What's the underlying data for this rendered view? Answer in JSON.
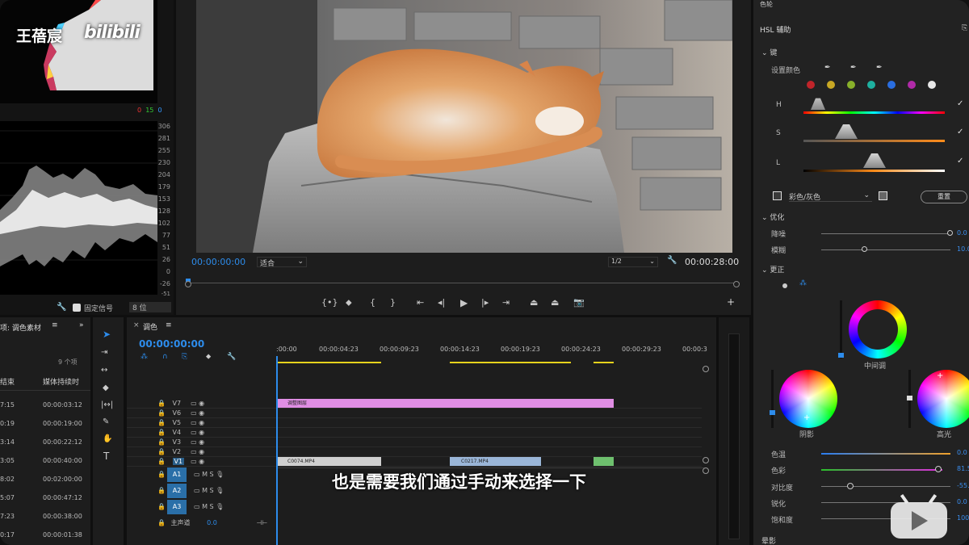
{
  "watermark": {
    "author": "王蓓宸",
    "brand": "bilibili"
  },
  "scope": {
    "ticks": [
      "306",
      "281",
      "255",
      "230",
      "204",
      "179",
      "153",
      "128",
      "102",
      "77",
      "51",
      "26",
      "0",
      "-26",
      "-51"
    ],
    "readout": [
      "0",
      "15",
      "0"
    ],
    "fixed_signal_label": "固定信号",
    "bitdepth": "8 位"
  },
  "monitor": {
    "timecode_in": "00:00:00:00",
    "fit_label": "适合",
    "res_label": "1/2",
    "timecode_out": "00:00:28:00"
  },
  "project": {
    "title": "项: 调色素材",
    "count": "9 个项",
    "col_end": "结束",
    "col_duration": "媒体持续时",
    "rows": [
      [
        "7:15",
        "00:00:03:12"
      ],
      [
        "0:19",
        "00:00:19:00"
      ],
      [
        "3:14",
        "00:00:22:12"
      ],
      [
        "3:05",
        "00:00:40:00"
      ],
      [
        "8:02",
        "00:02:00:00"
      ],
      [
        "5:07",
        "00:00:47:12"
      ],
      [
        "7:23",
        "00:00:38:00"
      ],
      [
        "0:17",
        "00:00:01:38"
      ]
    ]
  },
  "timeline": {
    "tab": "调色",
    "timecode": "00:00:00:00",
    "ruler": [
      ":00:00",
      "00:00:04:23",
      "00:00:09:23",
      "00:00:14:23",
      "00:00:19:23",
      "00:00:24:23",
      "00:00:29:23",
      "00:00:3"
    ],
    "video_tracks": [
      "V7",
      "V6",
      "V5",
      "V4",
      "V3",
      "V2",
      "V1"
    ],
    "audio_tracks": [
      "A1",
      "A2",
      "A3"
    ],
    "master_label": "主声道",
    "master_value": "0.0",
    "adjust_clip": "调整图层",
    "clips": [
      "C0074.MP4",
      "C0217.MP4",
      ""
    ]
  },
  "subtitle": "也是需要我们通过手动来选择一下",
  "lumetri": {
    "top": "色轮",
    "hsl": "HSL 辅助",
    "key": "键",
    "set_color": "设置颜色",
    "swatches": [
      "#c0242a",
      "#c8a824",
      "#88b02a",
      "#1eb0a0",
      "#2a6ee0",
      "#b02aa8",
      "#e8e8e8"
    ],
    "h": "H",
    "s": "S",
    "l": "L",
    "mode": "彩色/灰色",
    "reset": "重置",
    "refine": "优化",
    "denoise": "降噪",
    "denoise_val": "0.0",
    "blur": "模糊",
    "blur_val": "10.0",
    "correct": "更正",
    "midtone": "中间调",
    "shadow": "阴影",
    "highlight": "高光",
    "rows": [
      {
        "label": "色温",
        "value": "0.0"
      },
      {
        "label": "色彩",
        "value": "81.5"
      },
      {
        "label": "对比度",
        "value": "-55.7"
      },
      {
        "label": "锐化",
        "value": "0.0"
      },
      {
        "label": "饱和度",
        "value": "100.0"
      }
    ],
    "bottom": "晕影"
  }
}
